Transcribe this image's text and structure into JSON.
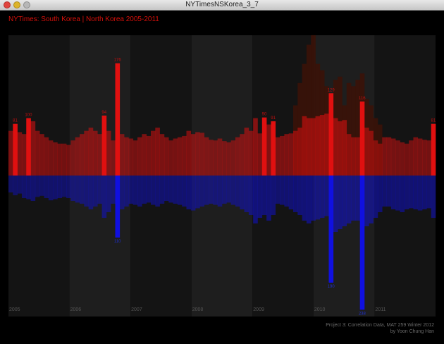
{
  "window": {
    "title": "NYTimesNSKorea_3_7"
  },
  "chart_data": {
    "type": "bar",
    "title": "NYTimes: South Korea | North Korea 2005-2011",
    "xlabel": "",
    "ylabel": "",
    "years": [
      "2005",
      "2006",
      "2007",
      "2008",
      "2009",
      "2010",
      "2011"
    ],
    "series": [
      {
        "name": "South Korea",
        "color": "#e01010",
        "direction": "up",
        "values": [
          70,
          81,
          68,
          65,
          90,
          85,
          70,
          65,
          60,
          55,
          52,
          50,
          50,
          48,
          55,
          60,
          65,
          70,
          75,
          70,
          65,
          94,
          70,
          55,
          176,
          65,
          60,
          58,
          55,
          60,
          65,
          62,
          70,
          75,
          65,
          60,
          55,
          58,
          60,
          62,
          70,
          65,
          68,
          67,
          60,
          56,
          55,
          58,
          54,
          52,
          55,
          60,
          65,
          75,
          70,
          90,
          66,
          91,
          80,
          85,
          60,
          62,
          65,
          66,
          70,
          75,
          93,
          90,
          90,
          93,
          95,
          97,
          129,
          90,
          85,
          87,
          65,
          60,
          60,
          116,
          75,
          70,
          55,
          50,
          60,
          60,
          58,
          55,
          52,
          50,
          55,
          60,
          58,
          56,
          55,
          81
        ],
        "labels": [
          {
            "index": 1,
            "text": "81"
          },
          {
            "index": 4,
            "text": "100"
          },
          {
            "index": 21,
            "text": "94"
          },
          {
            "index": 24,
            "text": "176"
          },
          {
            "index": 57,
            "text": "90"
          },
          {
            "index": 59,
            "text": "91"
          },
          {
            "index": 72,
            "text": "129"
          },
          {
            "index": 79,
            "text": "116"
          },
          {
            "index": 95,
            "text": "81"
          }
        ]
      },
      {
        "name": "North Korea",
        "color": "#1010e0",
        "direction": "down",
        "values": [
          30,
          35,
          32,
          40,
          42,
          45,
          38,
          36,
          40,
          44,
          42,
          40,
          38,
          40,
          45,
          48,
          50,
          55,
          60,
          55,
          50,
          75,
          65,
          50,
          110,
          60,
          55,
          50,
          52,
          55,
          50,
          48,
          52,
          55,
          50,
          45,
          48,
          50,
          52,
          55,
          60,
          62,
          58,
          55,
          52,
          50,
          52,
          55,
          50,
          48,
          52,
          55,
          60,
          65,
          70,
          85,
          75,
          70,
          80,
          70,
          50,
          52,
          55,
          60,
          65,
          70,
          80,
          85,
          80,
          78,
          75,
          72,
          190,
          100,
          95,
          90,
          85,
          80,
          80,
          238,
          90,
          85,
          75,
          65,
          55,
          55,
          60,
          62,
          65,
          60,
          58,
          60,
          62,
          60,
          58,
          75
        ],
        "labels": [
          {
            "index": 24,
            "text": "110"
          },
          {
            "index": 72,
            "text": "190"
          },
          {
            "index": 79,
            "text": "238"
          }
        ]
      }
    ],
    "background_series": {
      "name": "",
      "color": "#3a1208",
      "values": [
        0,
        0,
        0,
        0,
        0,
        0,
        0,
        0,
        0,
        0,
        0,
        0,
        0,
        0,
        0,
        0,
        0,
        0,
        0,
        0,
        0,
        0,
        0,
        0,
        0,
        0,
        0,
        0,
        0,
        0,
        0,
        0,
        0,
        0,
        0,
        0,
        0,
        0,
        0,
        0,
        0,
        0,
        0,
        0,
        0,
        0,
        0,
        0,
        0,
        0,
        0,
        0,
        0,
        0,
        0,
        0,
        0,
        0,
        0,
        0,
        0,
        0,
        0,
        0,
        110,
        145,
        175,
        205,
        220,
        175,
        165,
        140,
        120,
        150,
        155,
        110,
        145,
        140,
        150,
        160,
        120,
        110,
        90,
        80,
        0,
        0,
        0,
        0,
        0,
        0,
        0,
        0,
        0,
        0,
        0,
        0
      ]
    },
    "grid": false,
    "legend": "none"
  },
  "credits": {
    "line1": "Project 3: Correlation Data, MAT 259 Winter 2012",
    "line2": "by Yoon Chung Han"
  }
}
